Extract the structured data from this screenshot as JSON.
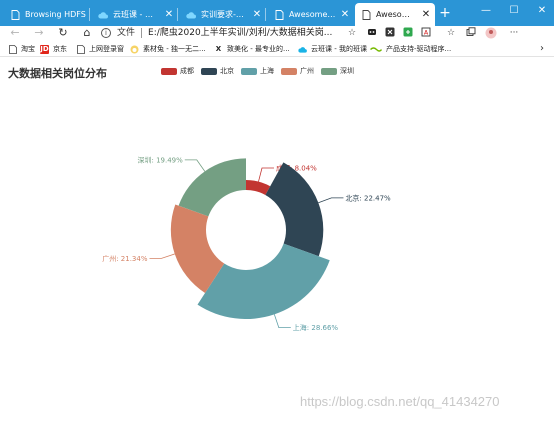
{
  "browser": {
    "tabs": [
      {
        "title": "Browsing HDFS",
        "icon": "document-icon",
        "active": false
      },
      {
        "title": "云班课 - 班课资源",
        "icon": "cloud-icon",
        "active": false
      },
      {
        "title": "实训要求-大数据...",
        "icon": "cloud-icon",
        "active": false
      },
      {
        "title": "Awesome-pyecha",
        "icon": "document-icon",
        "active": false
      },
      {
        "title": "Awesome-pyecha",
        "icon": "document-icon",
        "active": true
      }
    ],
    "new_tab": "+",
    "window_controls": {
      "minimize": "—",
      "maximize": "☐",
      "close": "✕"
    },
    "address": {
      "scheme_label": "文件",
      "url": "E:/爬虫2020上半年实训/刘利/大数据相关岗..."
    },
    "bookmarks": [
      {
        "label": "淘宝",
        "icon": "document-icon"
      },
      {
        "label": "京东",
        "icon": "jd-icon"
      },
      {
        "label": "上网登录窗",
        "icon": "document-icon"
      },
      {
        "label": "素材兔 - 独一无二...",
        "icon": "rabbit-icon"
      },
      {
        "label": "致美化 - 最专业的...",
        "icon": "x-logo-icon"
      },
      {
        "label": "云班课 - 我的班课",
        "icon": "cloud-icon"
      },
      {
        "label": "产品支持-驱动程序...",
        "icon": "nvidia-icon"
      }
    ],
    "bookmarks_more": "›"
  },
  "page": {
    "title": "大数据相关岗位分布",
    "watermark": "https://blog.csdn.net/qq_41434270"
  },
  "chart_data": {
    "type": "pie",
    "variant": "rose-donut",
    "title": "大数据相关岗位分布",
    "legend_position": "top",
    "slices": [
      {
        "name": "成都",
        "value": 8.04,
        "label": "成都: 8.04%",
        "color": "#c23531"
      },
      {
        "name": "北京",
        "value": 22.47,
        "label": "北京: 22.47%",
        "color": "#2f4554"
      },
      {
        "name": "上海",
        "value": 28.66,
        "label": "上海: 28.66%",
        "color": "#61a0a8"
      },
      {
        "name": "广州",
        "value": 21.34,
        "label": "广州: 21.34%",
        "color": "#d48265"
      },
      {
        "name": "深圳",
        "value": 19.49,
        "label": "深圳: 19.49%",
        "color": "#749f83"
      }
    ]
  }
}
